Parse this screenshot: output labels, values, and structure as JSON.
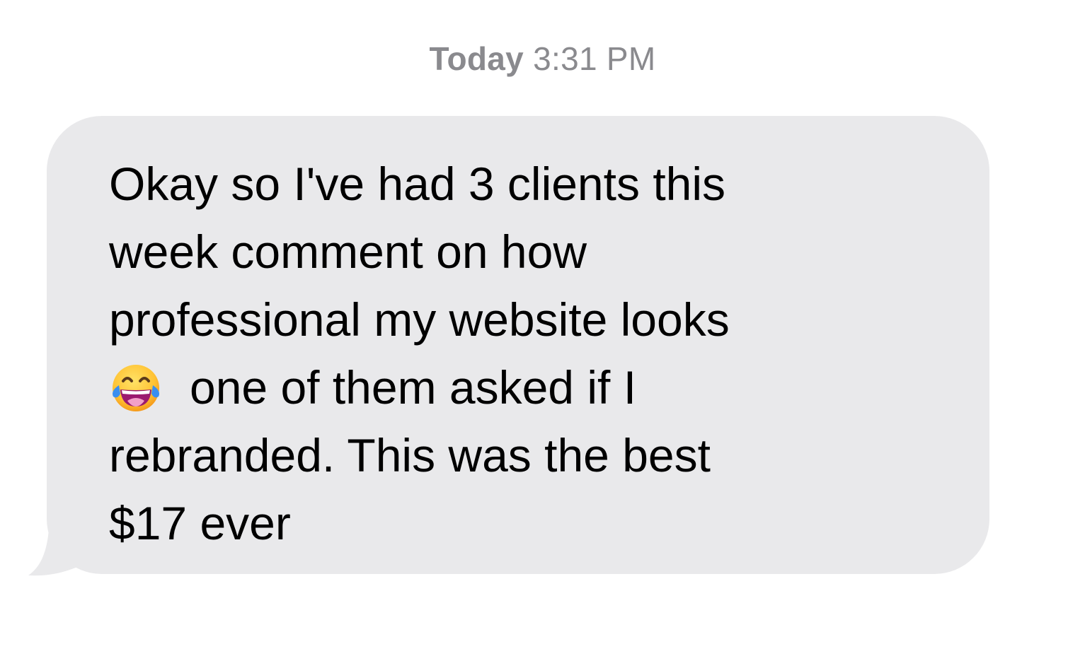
{
  "header": {
    "timestamp_day": "Today",
    "timestamp_time": "3:31 PM"
  },
  "message": {
    "bubble_color": "#e9e9eb",
    "text_color": "#000000",
    "lines": {
      "l1": "Okay so I've had 3 clients this",
      "l2": "week comment on how",
      "l3": "professional my website looks",
      "l4": "one of them asked if I",
      "l5": "rebranded. This was the best",
      "l6": "$17 ever"
    },
    "emoji": "face-with-tears-of-joy-icon"
  }
}
